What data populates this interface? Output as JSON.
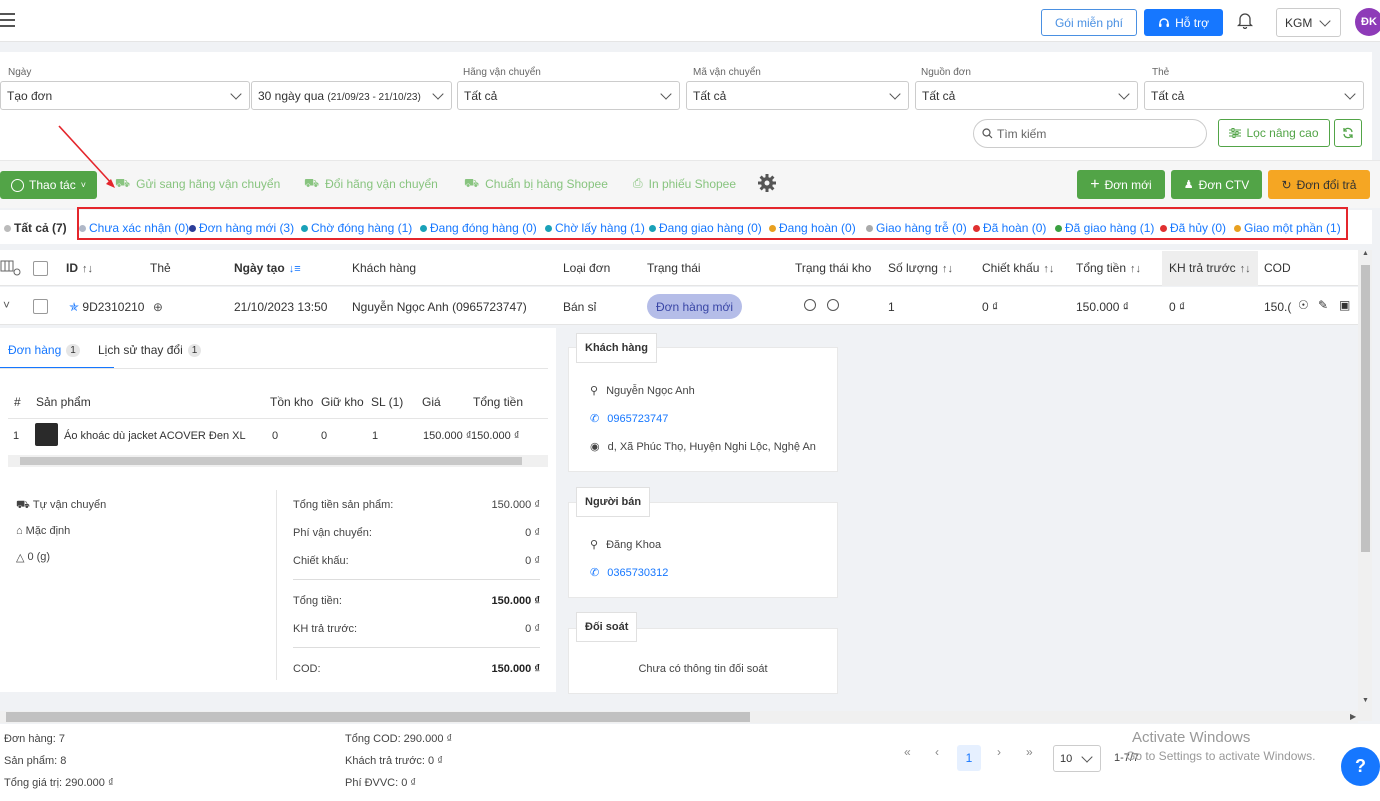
{
  "header": {
    "free_label": "Gói miễn phí",
    "support_label": "Hỗ trợ",
    "store_select": "KGM",
    "avatar_initials": "ĐK"
  },
  "filters": {
    "date_label": "Ngày",
    "date_type": "Tạo đơn",
    "date_range_main": "30 ngày qua",
    "date_range_detail": "(21/09/23 - 21/10/23)",
    "carrier_label": "Hãng vận chuyển",
    "carrier_value": "Tất cả",
    "tracking_label": "Mã vận chuyển",
    "tracking_value": "Tất cả",
    "source_label": "Nguồn đơn",
    "source_value": "Tất cả",
    "tag_label": "Thẻ",
    "tag_value": "Tất cả",
    "search_placeholder": "Tìm kiếm",
    "advanced_label": "Lọc nâng cao"
  },
  "actions": {
    "menu_label": "Thao tác",
    "send_carrier": "Gửi sang hãng vận chuyển",
    "change_carrier": "Đổi hãng vận chuyển",
    "prepare_shopee": "Chuẩn bị hàng Shopee",
    "print_shopee": "In phiếu Shopee",
    "new_order": "Đơn mới",
    "ctv_order": "Đơn CTV",
    "exchange_order": "Đơn đổi trả"
  },
  "status_tabs": [
    {
      "label": "Tất cả (7)",
      "color": "#bbbbbb"
    },
    {
      "label": "Chưa xác nhận (0)",
      "color": "#b0b8c8"
    },
    {
      "label": "Đơn hàng mới (3)",
      "color": "#2c3e99"
    },
    {
      "label": "Chờ đóng hàng (1)",
      "color": "#1aa1b8"
    },
    {
      "label": "Đang đóng hàng (0)",
      "color": "#1aa1b8"
    },
    {
      "label": "Chờ lấy hàng (1)",
      "color": "#1aa1b8"
    },
    {
      "label": "Đang giao hàng (0)",
      "color": "#1aa1b8"
    },
    {
      "label": "Đang hoàn (0)",
      "color": "#e8a020"
    },
    {
      "label": "Giao hàng trễ (0)",
      "color": "#aaaaaa"
    },
    {
      "label": "Đã hoàn (0)",
      "color": "#e03030"
    },
    {
      "label": "Đã giao hàng (1)",
      "color": "#3aa040"
    },
    {
      "label": "Đã hủy (0)",
      "color": "#e03030"
    },
    {
      "label": "Giao một phần (1)",
      "color": "#e8a020"
    }
  ],
  "table": {
    "headers": {
      "id": "ID",
      "tag": "Thẻ",
      "created": "Ngày tạo",
      "customer": "Khách hàng",
      "type": "Loại đơn",
      "status": "Trạng thái",
      "warehouse_status": "Trạng thái kho",
      "quantity": "Số lượng",
      "discount": "Chiết khấu",
      "total": "Tổng tiền",
      "prepaid": "KH trả trước",
      "cod": "COD"
    },
    "row": {
      "id": "9D2310210",
      "created": "21/10/2023 13:50",
      "customer": "Nguyễn Ngọc Anh (0965723747)",
      "type": "Bán sỉ",
      "status": "Đơn hàng mới",
      "quantity": "1",
      "discount": "0 ₫",
      "total": "150.000 ₫",
      "prepaid": "0 ₫",
      "cod": "150.("
    }
  },
  "detail": {
    "tab_orders": "Đơn hàng",
    "tab_orders_count": "1",
    "tab_history": "Lịch sử thay đổi",
    "tab_history_count": "1",
    "product_headers": {
      "num": "#",
      "product": "Sản phẩm",
      "stock": "Tồn kho",
      "held": "Giữ kho",
      "qty": "SL (1)",
      "price": "Giá",
      "total": "Tổng tiền"
    },
    "product": {
      "num": "1",
      "name": "Áo khoác dù jacket ACOVER Đen XL",
      "stock": "0",
      "held": "0",
      "qty": "1",
      "price": "150.000 ₫",
      "total": "150.000 ₫"
    },
    "shipping": {
      "method": "Tự vận chuyển",
      "warehouse": "Mặc định",
      "weight": "0 (g)"
    },
    "summary": {
      "subtotal_label": "Tổng tiền sản phẩm:",
      "subtotal": "150.000 ₫",
      "shipping_label": "Phí vận chuyển:",
      "shipping": "0 ₫",
      "discount_label": "Chiết khấu:",
      "discount": "0 ₫",
      "total_label": "Tổng tiền:",
      "total": "150.000 ₫",
      "prepaid_label": "KH trả trước:",
      "prepaid": "0 ₫",
      "cod_label": "COD:",
      "cod": "150.000 ₫"
    },
    "customer_card": {
      "title": "Khách hàng",
      "name": "Nguyễn Ngọc Anh",
      "phone": "0965723747",
      "address": "d, Xã Phúc Thọ, Huyện Nghi Lộc, Nghệ An"
    },
    "seller_card": {
      "title": "Người bán",
      "name": "Đăng Khoa",
      "phone": "0365730312"
    },
    "reconcile_card": {
      "title": "Đối soát",
      "empty": "Chưa có thông tin đối soát"
    }
  },
  "footer": {
    "orders": "Đơn hàng: 7",
    "products": "Sản phẩm: 8",
    "value": "Tổng giá trị: 290.000 ₫",
    "cod": "Tổng COD: 290.000 ₫",
    "prepaid": "Khách trả trước: 0 ₫",
    "shipping_fee": "Phí ĐVVC: 0 ₫",
    "page": "1",
    "page_size": "10",
    "range": "1-7/7"
  },
  "watermark": {
    "title": "Activate Windows",
    "subtitle": "Go to Settings to activate Windows."
  }
}
